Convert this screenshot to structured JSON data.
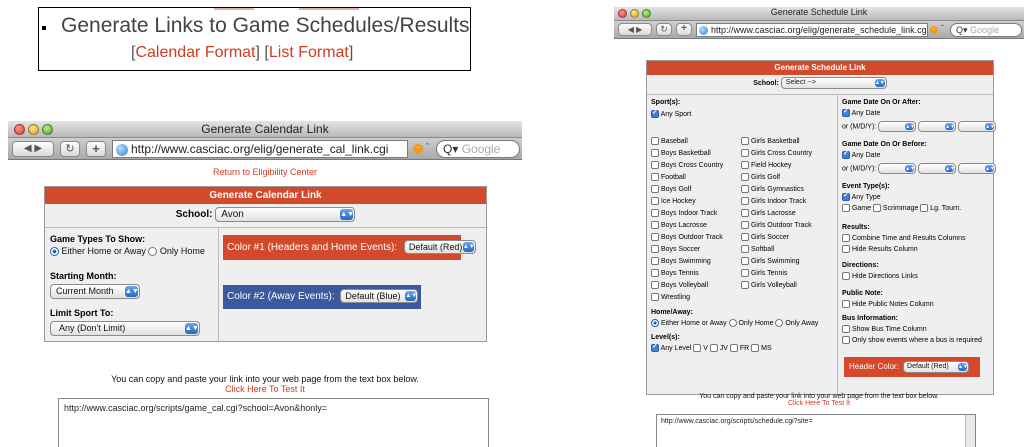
{
  "callout": {
    "title": "Generate Links to Game Schedules/Results",
    "open1": "[",
    "link_calendar": "Calendar Format",
    "close1": "]",
    "open2": "[",
    "link_list": "List Format",
    "close2": "]"
  },
  "calendar_window": {
    "title": "Generate Calendar Link",
    "url": "http://www.casciac.org/elig/generate_cal_link.cgi",
    "search_placeholder": "Google",
    "return_link": "Return to Eligibility Center",
    "panel_title": "Generate Calendar Link",
    "school_label": "School:",
    "school_value": "Avon",
    "game_types_label": "Game Types To Show:",
    "game_types_options": [
      "Either Home or Away",
      "Only Home"
    ],
    "starting_month_label": "Starting Month:",
    "starting_month_value": "Current Month",
    "limit_sport_label": "Limit Sport To:",
    "limit_sport_value": "Any (Don't Limit)",
    "color1_label": "Color #1 (Headers and Home Events):",
    "color1_value": "Default (Red)",
    "color2_label": "Color #2 (Away Events):",
    "color2_value": "Default (Blue)",
    "copy_text": "You can copy and paste your link into your web page from the text box below.",
    "test_link": "Click Here To Test It",
    "link_box_value": "http://www.casciac.org/scripts/game_cal.cgi?school=Avon&honly=",
    "colors": {
      "header": "#d24a2b",
      "color1": "#d24a2b",
      "color2": "#3a5a9e"
    }
  },
  "schedule_window": {
    "title": "Generate Schedule Link",
    "url": "http://www.casciac.org/elig/generate_schedule_link.cg",
    "search_placeholder": "Google",
    "panel_title": "Generate Schedule Link",
    "school_label": "School:",
    "school_value": "Select -->",
    "sports_label": "Sport(s):",
    "any_sport": "Any Sport",
    "sports_left": [
      "Baseball",
      "Boys Basketball",
      "Boys Cross Country",
      "Football",
      "Boys Golf",
      "Ice Hockey",
      "Boys Indoor Track",
      "Boys Lacrosse",
      "Boys Outdoor Track",
      "Boys Soccer",
      "Boys Swimming",
      "Boys Tennis",
      "Boys Volleyball",
      "Wrestling"
    ],
    "sports_right": [
      "Girls Basketball",
      "Girls Cross Country",
      "Field Hockey",
      "Girls Golf",
      "Girls Gymnastics",
      "Girls Indoor Track",
      "Girls Lacrosse",
      "Girls Outdoor Track",
      "Girls Soccer",
      "Softball",
      "Girls Swimming",
      "Girls Tennis",
      "Girls Volleyball"
    ],
    "home_away_label": "Home/Away:",
    "home_away_options": [
      "Either Home or Away",
      "Only Home",
      "Only Away"
    ],
    "levels_label": "Level(s):",
    "levels": [
      "Any Level",
      "V",
      "JV",
      "FR",
      "MS"
    ],
    "date_after_label": "Game Date On Or After:",
    "date_before_label": "Game Date On Or Before:",
    "any_date": "Any Date",
    "or_mdy": "or (M/D/Y):",
    "event_types_label": "Event Type(s):",
    "any_type": "Any Type",
    "event_types": [
      "Game",
      "Scrimmage",
      "Lg. Tourn."
    ],
    "results_label": "Results:",
    "results_options": [
      "Combine Time and Results Columns",
      "Hide Results Column"
    ],
    "directions_label": "Directions:",
    "directions_option": "Hide Directions Links",
    "public_note_label": "Public Note:",
    "public_note_option": "Hide Public Notes Column",
    "bus_label": "Bus Information:",
    "bus_options": [
      "Show Bus Time Column",
      "Only show events where a bus is required"
    ],
    "header_color_label": "Header Color:",
    "header_color_value": "Default (Red)",
    "copy_text": "You can copy and paste your link into your web page from the text box below.",
    "test_link": "Click Here To Test It",
    "link_box_value": "http://www.casciac.org/scripts/schedule.cgi?site="
  }
}
